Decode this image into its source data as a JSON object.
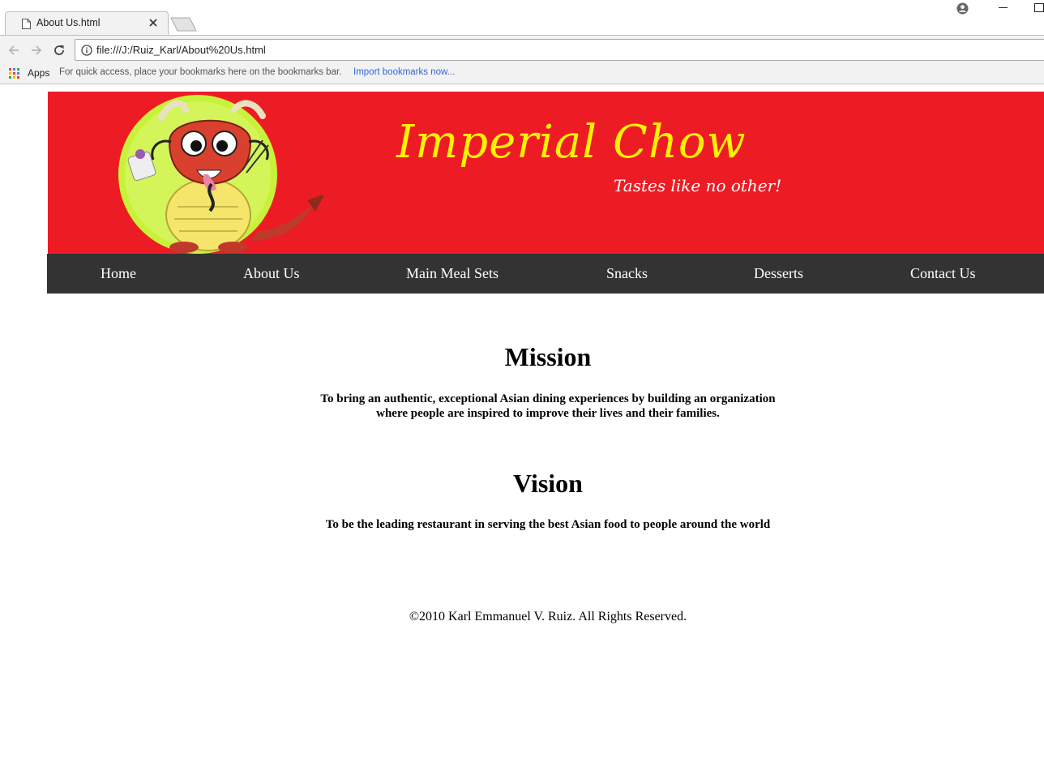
{
  "browser": {
    "tab_title": "About Us.html",
    "url": "file:///J:/Ruiz_Karl/About%20Us.html",
    "apps_label": "Apps",
    "bookmarks_hint": "For quick access, place your bookmarks here on the bookmarks bar.",
    "import_link": "Import bookmarks now..."
  },
  "banner": {
    "brand_name": "Imperial Chow",
    "tagline": "Tastes like no other!",
    "background_color": "#ed1c24",
    "brand_color": "#fff200"
  },
  "nav": {
    "items": [
      {
        "label": "Home"
      },
      {
        "label": "About Us"
      },
      {
        "label": "Main Meal Sets"
      },
      {
        "label": "Snacks"
      },
      {
        "label": "Desserts"
      },
      {
        "label": "Contact Us"
      }
    ],
    "background_color": "#333333"
  },
  "mission": {
    "title": "Mission",
    "text_line1": "To bring an authentic, exceptional Asian dining experiences by building an organization",
    "text_line2": "where people are inspired to improve their lives and their families."
  },
  "vision": {
    "title": "Vision",
    "text": "To be the leading restaurant in serving the best Asian food to people around the world"
  },
  "footer": {
    "copyright": "©2010 Karl Emmanuel V. Ruiz. All Rights Reserved."
  }
}
